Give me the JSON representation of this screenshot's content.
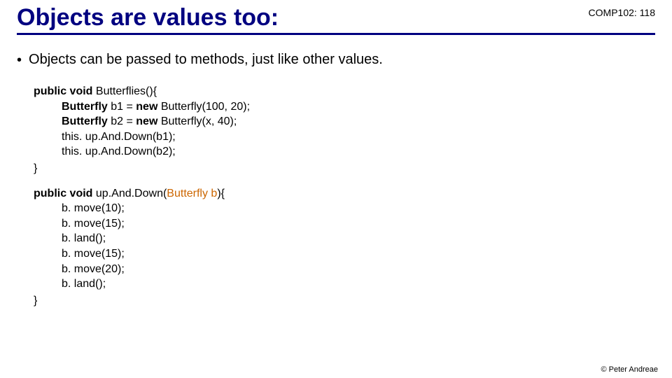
{
  "header": {
    "course_code": "COMP102: 118",
    "title": "Objects are values too:"
  },
  "bullet_text": "Objects can be passed to methods, just like other values.",
  "code1": {
    "sig_kw1": "public void",
    "sig_name": " Butterflies(){",
    "l1_type": "Butterfly",
    "l1_rest": " b1 =  ",
    "l1_new": "new",
    "l1_end": " Butterfly(100, 20);",
    "l2_type": "Butterfly",
    "l2_rest": " b2 = ",
    "l2_new": "new",
    "l2_end": " Butterfly(x, 40);",
    "l3": "this. up.And.Down(b1);",
    "l4": "this. up.And.Down(b2);",
    "close": "}"
  },
  "code2": {
    "sig_kw1": "public void",
    "sig_name": " up.And.Down(",
    "sig_param": "Butterfly b",
    "sig_end": "){",
    "l1": "b. move(10);",
    "l2": "b. move(15);",
    "l3": "b. land();",
    "l4": "b. move(15);",
    "l5": "b. move(20);",
    "l6": "b. land();",
    "close": "}"
  },
  "footer": "© Peter Andreae"
}
